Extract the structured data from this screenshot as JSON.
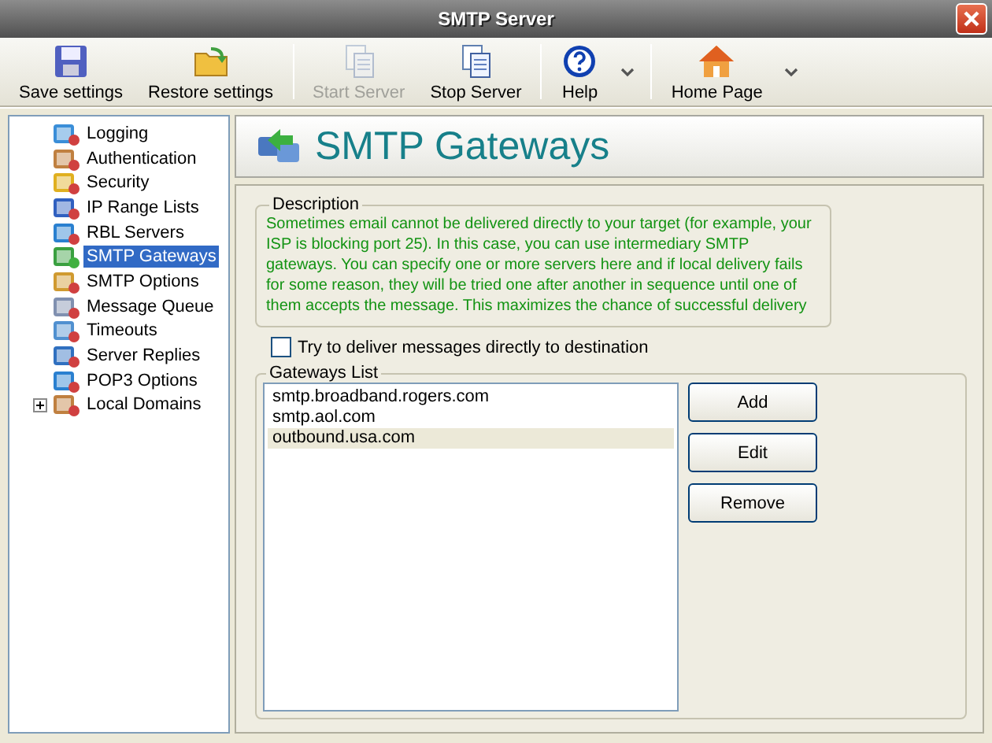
{
  "window": {
    "title": "SMTP Server"
  },
  "toolbar": {
    "groups": [
      {
        "buttons": [
          {
            "label": "Save settings",
            "kind": "save",
            "disabled": false
          },
          {
            "label": "Restore settings",
            "kind": "restore",
            "disabled": false
          }
        ]
      },
      {
        "buttons": [
          {
            "label": "Start Server",
            "kind": "start",
            "disabled": true
          },
          {
            "label": "Stop Server",
            "kind": "stop",
            "disabled": false
          }
        ]
      },
      {
        "buttons": [
          {
            "label": "Help",
            "kind": "help",
            "disabled": false
          },
          {
            "kind": "dropdown",
            "disabled": false
          }
        ]
      },
      {
        "buttons": [
          {
            "label": "Home Page",
            "kind": "home",
            "disabled": false
          },
          {
            "kind": "dropdown",
            "disabled": false
          }
        ]
      }
    ]
  },
  "sidebar": {
    "items": [
      {
        "label": "Logging",
        "kind": "check",
        "selected": false
      },
      {
        "label": "Authentication",
        "kind": "user",
        "selected": false
      },
      {
        "label": "Security",
        "kind": "lock",
        "selected": false
      },
      {
        "label": "IP Range Lists",
        "kind": "list",
        "selected": false
      },
      {
        "label": "RBL Servers",
        "kind": "globe",
        "selected": false
      },
      {
        "label": "SMTP Gateways",
        "kind": "gateway",
        "selected": true
      },
      {
        "label": "SMTP Options",
        "kind": "options",
        "selected": false
      },
      {
        "label": "Message Queue",
        "kind": "queue",
        "selected": false
      },
      {
        "label": "Timeouts",
        "kind": "clock",
        "selected": false
      },
      {
        "label": "Server Replies",
        "kind": "pen",
        "selected": false
      },
      {
        "label": "POP3 Options",
        "kind": "globe",
        "selected": false
      },
      {
        "label": "Local Domains",
        "kind": "user",
        "selected": false,
        "expanded": false
      }
    ]
  },
  "page": {
    "title": "SMTP Gateways",
    "description": {
      "legend": "Description",
      "text": "Sometimes email cannot be delivered directly to your target (for example, your ISP is blocking port 25). In this case, you can use intermediary SMTP gateways. You can specify one or more servers here and if local delivery fails for some reason, they will be tried one after another in sequence until one of them accepts the message. This maximizes the chance of successful delivery"
    },
    "direct_delivery": {
      "label": "Try to deliver messages directly to destination",
      "checked": false
    },
    "gateways": {
      "legend": "Gateways List",
      "items": [
        {
          "text": "smtp.broadband.rogers.com",
          "selected": false
        },
        {
          "text": "smtp.aol.com",
          "selected": false
        },
        {
          "text": "outbound.usa.com",
          "selected": true
        }
      ],
      "buttons": [
        "Add",
        "Edit",
        "Remove"
      ]
    }
  }
}
